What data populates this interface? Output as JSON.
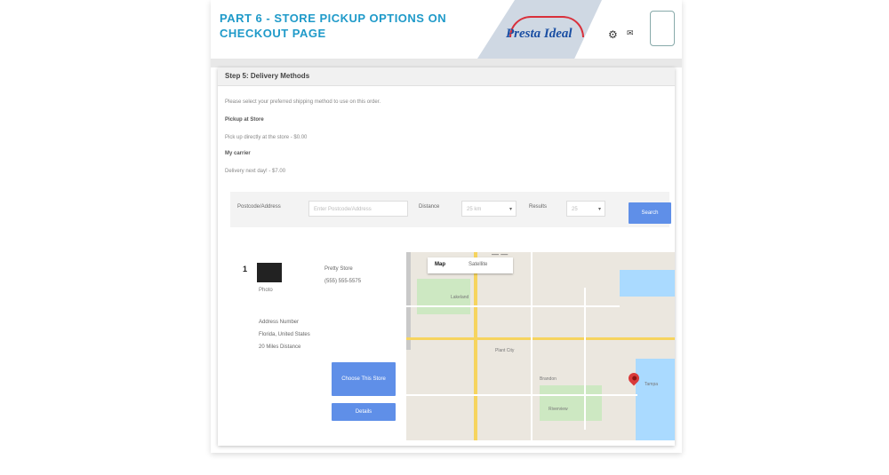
{
  "banner": {
    "title": "PART 6 - STORE PICKUP OPTIONS ON CHECKOUT PAGE",
    "logo_text": "Presta Ideal",
    "icon_names": [
      "gear-icon",
      "chat-icon",
      "bot-icon"
    ]
  },
  "panel": {
    "heading": "Step 5: Delivery Methods",
    "intro": "Please select your preferred shipping method to use on this order.",
    "option1_label": "Pickup at Store",
    "option1_desc": "Pick up directly at the store - $0.00",
    "option2_label": "My carrier",
    "option2_desc": "Delivery next day! - $7.00"
  },
  "filter": {
    "postcode_label": "Postcode/Address",
    "postcode_placeholder": "Enter Postcode/Address",
    "distance_label": "Distance",
    "distance_value": "25 km",
    "results_label": "Results",
    "results_value": "25",
    "search_button": "Search"
  },
  "store": {
    "number": "1",
    "name": "Pretty Store",
    "phone": "(555) 555-5575",
    "thumb_caption": "Photo",
    "address_line1": "Address Number",
    "address_line2": "Florida, United States",
    "address_line3": "20 Miles Distance",
    "select_button": "Choose This Store",
    "details_button": "Details"
  },
  "map": {
    "tab_map": "Map",
    "tab_satellite": "Satellite",
    "zoom_indicator": "— —",
    "labels": [
      "Lakeland",
      "Plant City",
      "Brandon",
      "Riverview",
      "Tampa"
    ]
  },
  "colors": {
    "accent": "#1f9ac9",
    "button_blue": "#5f8fe8",
    "pin_red": "#d93a3a"
  }
}
